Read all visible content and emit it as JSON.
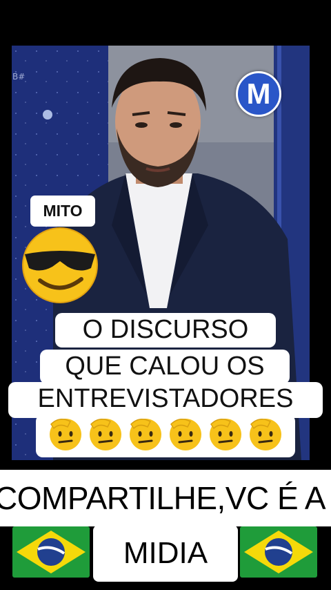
{
  "video": {
    "channel_badge": "M",
    "corner_tag": "B#"
  },
  "sticker": {
    "label": "MITO",
    "emoji_icon": "smiling-face-with-sunglasses-icon"
  },
  "caption": {
    "line1": "O DISCURSO",
    "line2": "QUE CALOU OS",
    "line3": "ENTREVISTADORES",
    "emoji_icon": "saluting-face-icon",
    "emoji_count": 6
  },
  "banner": {
    "text": "COMPARTILHE,VC É A",
    "line2": "MIDIA",
    "flag_icon": "brazil-flag-icon"
  },
  "colors": {
    "background": "#000000",
    "studio_blue": "#1c2a5e",
    "badge_blue": "#2a56c8",
    "flag_green": "#1f9c3a",
    "flag_yellow": "#f5d90a",
    "flag_blue": "#21408f"
  }
}
